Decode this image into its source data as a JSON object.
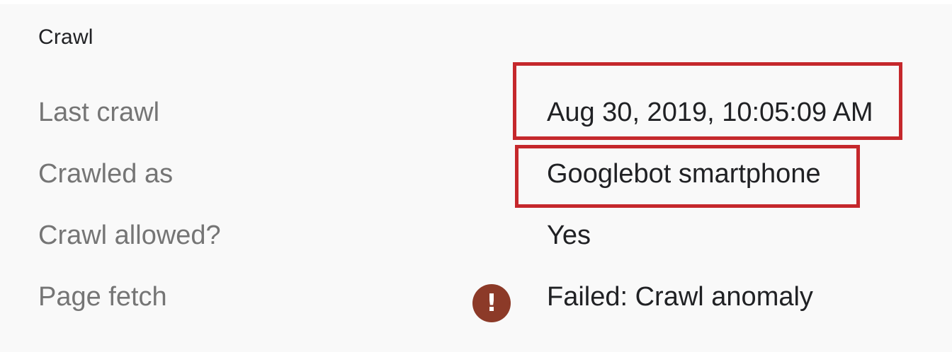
{
  "section": {
    "title": "Crawl"
  },
  "rows": [
    {
      "label": "Last crawl",
      "value": "Aug 30, 2019, 10:05:09 AM"
    },
    {
      "label": "Crawled as",
      "value": "Googlebot smartphone"
    },
    {
      "label": "Crawl allowed?",
      "value": "Yes"
    },
    {
      "label": "Page fetch",
      "value": "Failed: Crawl anomaly",
      "status_icon": "error-icon"
    }
  ],
  "colors": {
    "highlight": "#c5282c",
    "error_icon": "#8c3a28",
    "label_text": "#757575",
    "value_text": "#202124",
    "background": "#f9f9f9"
  },
  "icons": {
    "error_glyph": "!"
  }
}
